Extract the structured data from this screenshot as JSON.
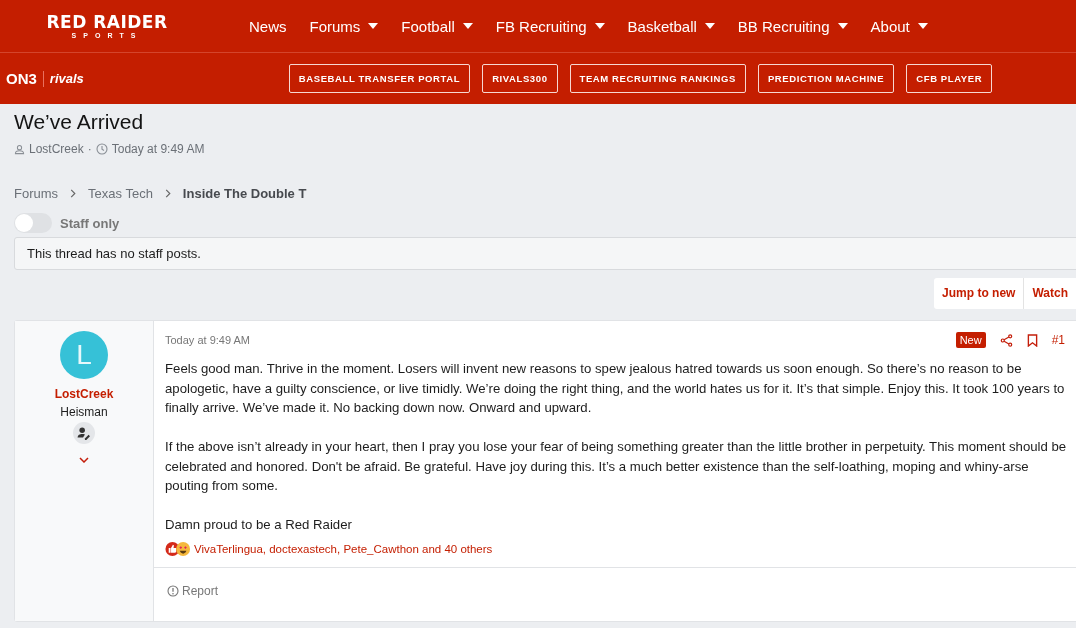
{
  "header": {
    "logo_title": "RED RAIDER",
    "logo_subtitle": "SPORTS",
    "nav": [
      {
        "label": "News",
        "dropdown": false
      },
      {
        "label": "Forums",
        "dropdown": true
      },
      {
        "label": "Football",
        "dropdown": true
      },
      {
        "label": "FB Recruiting",
        "dropdown": true
      },
      {
        "label": "Basketball",
        "dropdown": true
      },
      {
        "label": "BB Recruiting",
        "dropdown": true
      },
      {
        "label": "About",
        "dropdown": true
      }
    ]
  },
  "subheader": {
    "on3_logo": "ON3",
    "rivals_logo": "rivals",
    "links": [
      "BASEBALL TRANSFER PORTAL",
      "RIVALS300",
      "TEAM RECRUITING RANKINGS",
      "PREDICTION MACHINE",
      "CFB PLAYER"
    ]
  },
  "thread": {
    "title": "We’ve Arrived",
    "author": "LostCreek",
    "separator": "·",
    "time": "Today at 9:49 AM"
  },
  "breadcrumbs": [
    {
      "label": "Forums",
      "current": false
    },
    {
      "label": "Texas Tech",
      "current": false
    },
    {
      "label": "Inside The Double T",
      "current": true
    }
  ],
  "staff_only": {
    "label": "Staff only",
    "on": false
  },
  "staff_notice": "This thread has no staff posts.",
  "thread_actions": [
    "Jump to new",
    "Watch"
  ],
  "post": {
    "avatar_letter": "L",
    "username": "LostCreek",
    "user_title": "Heisman",
    "time": "Today at 9:49 AM",
    "new_badge": "New",
    "number": "#1",
    "paragraphs": [
      "Feels good man. Thrive in the moment. Losers will invent new reasons to spew jealous hatred towards us soon enough. So there’s no reason to be apologetic, have a guilty conscience, or live timidly. We’re doing the right thing, and the world hates us for it. It’s that simple. Enjoy this. It took 100 years to finally arrive. We’ve made it. No backing down now. Onward and upward.",
      "If the above isn’t already in your heart, then I pray you lose your fear of being something greater than the little brother in perpetuity. This moment should be celebrated and honored. Don't be afraid. Be grateful. Have joy during this. It’s a much better existence than the self-loathing, moping and whiny-arse pouting from some.",
      "Damn proud to be a Red Raider"
    ],
    "reactions": "VivaTerlingua, doctexastech, Pete_Cawthon and 40 others",
    "report": "Report"
  }
}
